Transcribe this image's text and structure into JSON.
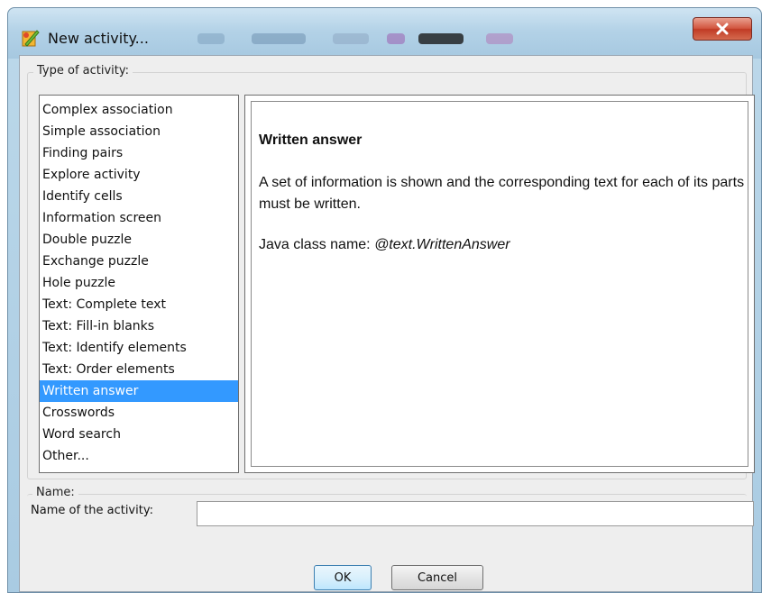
{
  "window": {
    "title": "New activity...",
    "icon": "app-activity-icon",
    "close_icon": "close-icon"
  },
  "type_group": {
    "label": "Type of activity:",
    "items": [
      "Complex association",
      "Simple association",
      "Finding pairs",
      "Explore activity",
      "Identify cells",
      "Information screen",
      "Double puzzle",
      "Exchange puzzle",
      "Hole puzzle",
      "Text: Complete text",
      "Text: Fill-in blanks",
      "Text: Identify elements",
      "Text: Order elements",
      "Written answer",
      "Crosswords",
      "Word search",
      "Other..."
    ],
    "selected": "Written answer"
  },
  "description": {
    "title": "Written answer",
    "body": "A set of information is shown and the corresponding text for each of its parts must be written.",
    "java_label": "Java class name: ",
    "java_class": "@text.WrittenAnswer"
  },
  "name_group": {
    "label": "Name:",
    "field_label": "Name of the activity:",
    "field_value": ""
  },
  "buttons": {
    "ok": "OK",
    "cancel": "Cancel"
  },
  "colors": {
    "selection": "#3399ff",
    "close_button": "#c9452f"
  }
}
